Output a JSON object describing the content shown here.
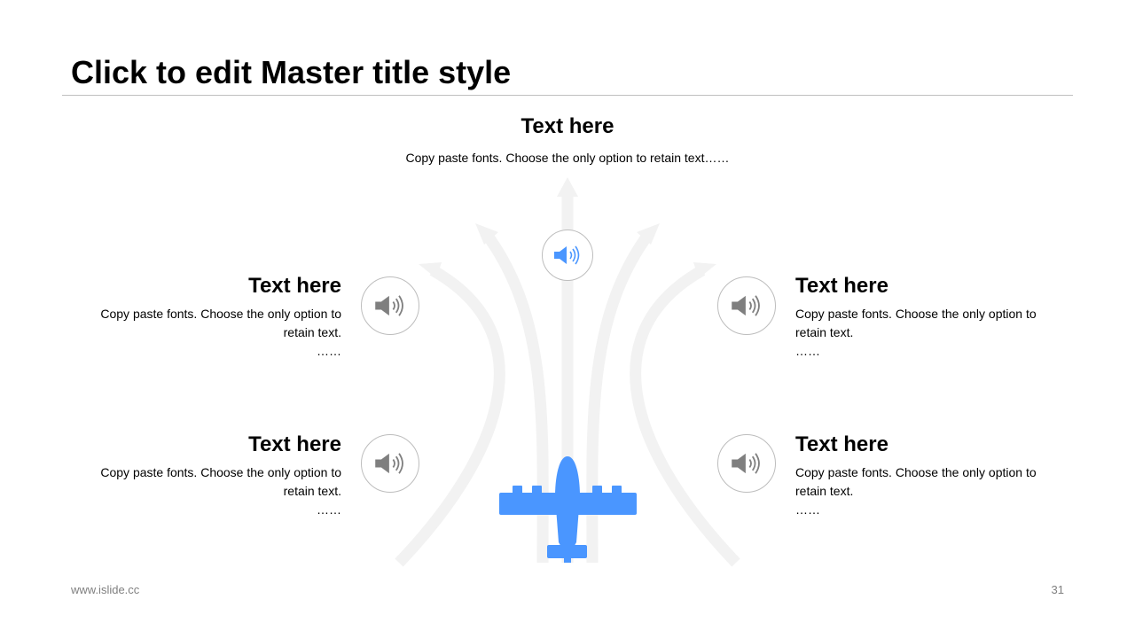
{
  "title": "Click to edit Master title style",
  "top": {
    "heading": "Text here",
    "desc": "Copy paste fonts. Choose the only option to retain text……"
  },
  "items": [
    {
      "heading": "Text here",
      "desc": "Copy paste fonts. Choose the only option to retain text.",
      "ellipsis": "……"
    },
    {
      "heading": "Text here",
      "desc": "Copy paste fonts. Choose the only option to retain text.",
      "ellipsis": "……"
    },
    {
      "heading": "Text here",
      "desc": "Copy paste fonts. Choose the only option to retain text.",
      "ellipsis": "……"
    },
    {
      "heading": "Text here",
      "desc": "Copy paste fonts. Choose the only option to retain text.",
      "ellipsis": "……"
    }
  ],
  "icons": {
    "speaker": "speaker-icon",
    "plane": "airplane-icon"
  },
  "colors": {
    "accent": "#4a96ff",
    "icon_gray": "#7f7f7f",
    "arrow_bg": "#f2f2f2"
  },
  "footer": {
    "website": "www.islide.cc",
    "page_number": "31"
  }
}
